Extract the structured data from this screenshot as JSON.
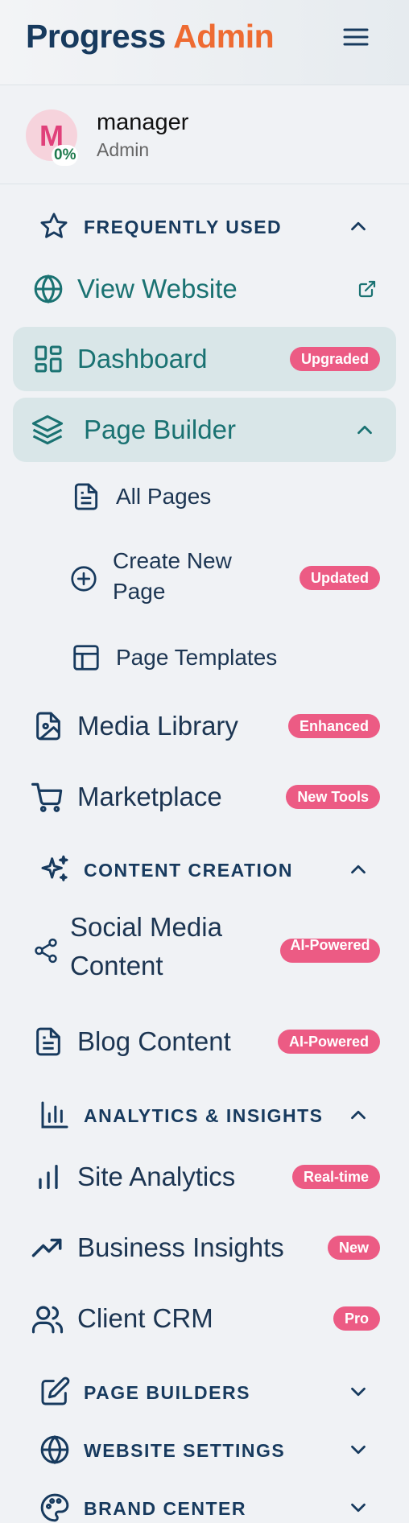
{
  "header": {
    "brand_primary": "Progress",
    "brand_accent": "Admin"
  },
  "user": {
    "initial": "M",
    "progress": "0%",
    "name": "manager",
    "role": "Admin"
  },
  "sections": {
    "frequently_used": "FREQUENTLY USED",
    "content_creation": "CONTENT CREATION",
    "analytics": "ANALYTICS & INSIGHTS",
    "page_builders": "PAGE BUILDERS",
    "website_settings": "WEBSITE SETTINGS",
    "brand_center": "BRAND CENTER"
  },
  "nav": {
    "view_website": {
      "label": "View Website"
    },
    "dashboard": {
      "label": "Dashboard",
      "badge": "Upgraded"
    },
    "page_builder": {
      "label": "Page Builder"
    },
    "all_pages": {
      "label": "All Pages"
    },
    "create_new_page": {
      "label_line1": "Create New",
      "label_line2": "Page",
      "badge": "Updated"
    },
    "page_templates": {
      "label": "Page Templates"
    },
    "media_library": {
      "label": "Media Library",
      "badge": "Enhanced"
    },
    "marketplace": {
      "label": "Marketplace",
      "badge": "New Tools"
    },
    "social_media": {
      "label_line1": "Social Media",
      "label_line2": "Content",
      "badge": "AI-Powered"
    },
    "blog_content": {
      "label": "Blog Content",
      "badge": "AI-Powered"
    },
    "site_analytics": {
      "label": "Site Analytics",
      "badge": "Real-time"
    },
    "business_insights": {
      "label": "Business Insights",
      "badge": "New"
    },
    "client_crm": {
      "label": "Client CRM",
      "badge": "Pro"
    }
  },
  "colors": {
    "navy": "#173a5e",
    "orange": "#ee6b32",
    "teal": "#1a7272",
    "badge_pink": "#ec5b84",
    "active_bg": "#d9e6e8"
  },
  "icons": [
    "menu-icon",
    "star-icon",
    "globe-icon",
    "external-link-icon",
    "dashboard-icon",
    "layers-icon",
    "file-text-icon",
    "plus-circle-icon",
    "layout-icon",
    "image-file-icon",
    "cart-icon",
    "sparkles-icon",
    "share-icon",
    "bar-chart-icon",
    "trending-up-icon",
    "users-icon",
    "edit-icon",
    "palette-icon",
    "chevron-up-icon",
    "chevron-down-icon"
  ]
}
